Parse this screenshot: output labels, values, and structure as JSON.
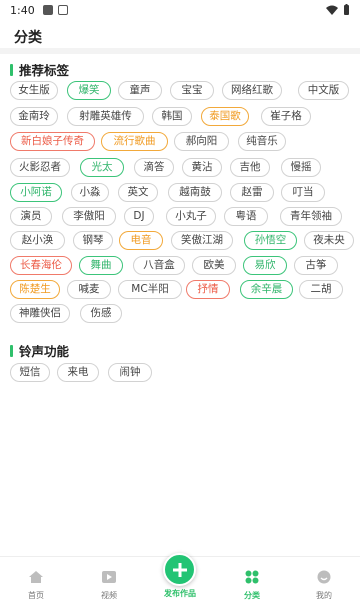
{
  "status_bar": {
    "time": "1:40"
  },
  "page_title": "分类",
  "sections": {
    "tags_title": "推荐标签",
    "ringtone_title": "铃声功能"
  },
  "tags": [
    {
      "label": "女生版",
      "style": "default"
    },
    {
      "label": "爆笑",
      "style": "green"
    },
    {
      "label": "童声",
      "style": "default"
    },
    {
      "label": "宝宝",
      "style": "default"
    },
    {
      "label": "网络红歌",
      "style": "default"
    },
    {
      "label": "中文版",
      "style": "default"
    },
    {
      "label": "金南玲",
      "style": "default"
    },
    {
      "label": "射雕英雄传",
      "style": "default"
    },
    {
      "label": "韩国",
      "style": "default"
    },
    {
      "label": "泰国歌",
      "style": "orange"
    },
    {
      "label": "崔子格",
      "style": "default"
    },
    {
      "label": "新白娘子传奇",
      "style": "red"
    },
    {
      "label": "流行歌曲",
      "style": "orange"
    },
    {
      "label": "郝向阳",
      "style": "default"
    },
    {
      "label": "纯音乐",
      "style": "default"
    },
    {
      "label": "火影忍者",
      "style": "default"
    },
    {
      "label": "光太",
      "style": "green"
    },
    {
      "label": "滴答",
      "style": "default"
    },
    {
      "label": "黄沾",
      "style": "default"
    },
    {
      "label": "吉他",
      "style": "default"
    },
    {
      "label": "慢摇",
      "style": "default"
    },
    {
      "label": "小阿诺",
      "style": "green"
    },
    {
      "label": "小淼",
      "style": "default"
    },
    {
      "label": "英文",
      "style": "default"
    },
    {
      "label": "越南鼓",
      "style": "default"
    },
    {
      "label": "赵雷",
      "style": "default"
    },
    {
      "label": "叮当",
      "style": "default"
    },
    {
      "label": "演员",
      "style": "default"
    },
    {
      "label": "李傲阳",
      "style": "default"
    },
    {
      "label": "DJ",
      "style": "default"
    },
    {
      "label": "小丸子",
      "style": "default"
    },
    {
      "label": "粤语",
      "style": "default"
    },
    {
      "label": "青年领袖",
      "style": "default"
    },
    {
      "label": "赵小涣",
      "style": "default"
    },
    {
      "label": "钢琴",
      "style": "default"
    },
    {
      "label": "电音",
      "style": "orange"
    },
    {
      "label": "笑傲江湖",
      "style": "default"
    },
    {
      "label": "孙悟空",
      "style": "green"
    },
    {
      "label": "夜未央",
      "style": "default"
    },
    {
      "label": "长春海伦",
      "style": "red"
    },
    {
      "label": "舞曲",
      "style": "green"
    },
    {
      "label": "八音盒",
      "style": "default"
    },
    {
      "label": "欧美",
      "style": "default"
    },
    {
      "label": "易欣",
      "style": "green"
    },
    {
      "label": "古筝",
      "style": "default"
    },
    {
      "label": "陈楚生",
      "style": "orange"
    },
    {
      "label": "喊麦",
      "style": "default"
    },
    {
      "label": "MC半阳",
      "style": "default"
    },
    {
      "label": "抒情",
      "style": "red"
    },
    {
      "label": "余辛晨",
      "style": "green"
    },
    {
      "label": "二胡",
      "style": "default"
    },
    {
      "label": "神雕侠侣",
      "style": "default"
    },
    {
      "label": "伤感",
      "style": "default"
    }
  ],
  "ringtone_functions": [
    {
      "label": "短信"
    },
    {
      "label": "来电"
    },
    {
      "label": "闹钟"
    }
  ],
  "bottom_nav": {
    "home": "首页",
    "video": "视频",
    "publish": "发布作品",
    "category": "分类",
    "mine": "我的"
  },
  "colors": {
    "accent_green": "#2fc06b",
    "orange": "#f09a20",
    "red": "#ec5a45"
  }
}
